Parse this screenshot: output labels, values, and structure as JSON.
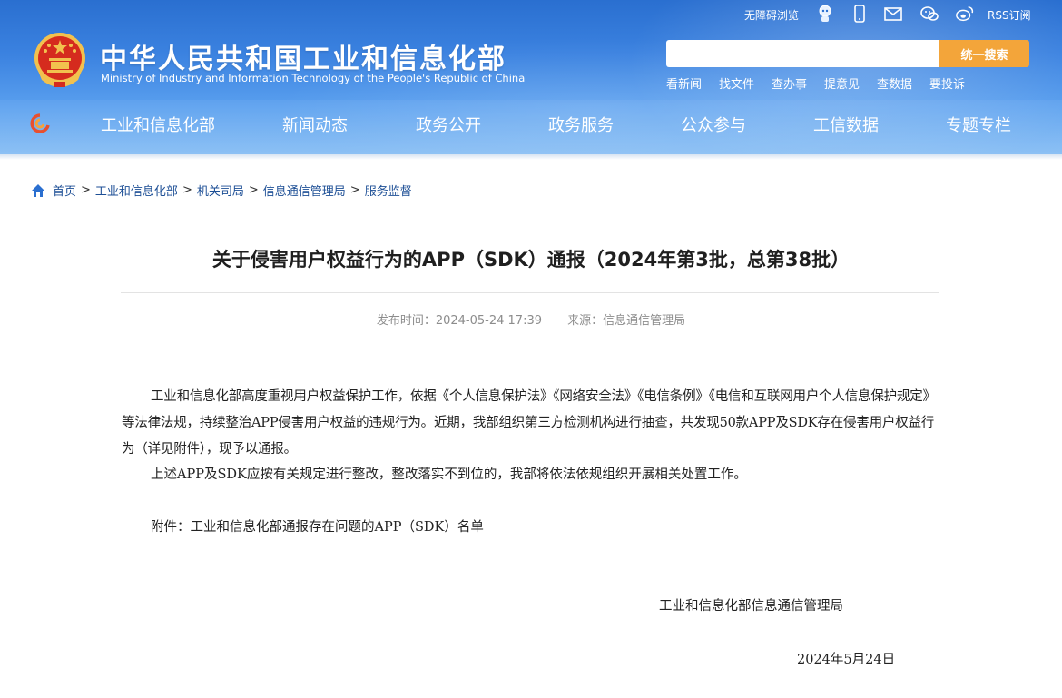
{
  "header": {
    "title": "中华人民共和国工业和信息化部",
    "subtitle": "Ministry of Industry and Information Technology of the People's Republic of China",
    "accessibility": "无障碍浏览",
    "rss": "RSS订阅",
    "search_placeholder": "",
    "search_button": "统一搜索",
    "quick_links": [
      "看新闻",
      "找文件",
      "查办事",
      "提意见",
      "查数据",
      "要投诉"
    ]
  },
  "nav": {
    "items": [
      "工业和信息化部",
      "新闻动态",
      "政务公开",
      "政务服务",
      "公众参与",
      "工信数据",
      "专题专栏"
    ]
  },
  "breadcrumb": {
    "items": [
      "首页",
      "工业和信息化部",
      "机关司局",
      "信息通信管理局",
      "服务监督"
    ],
    "separator": ">"
  },
  "article": {
    "title": "关于侵害用户权益行为的APP（SDK）通报（2024年第3批，总第38批）",
    "publish_time": "发布时间：2024-05-24 17:39",
    "source": "来源：信息通信管理局",
    "paragraph1": "工业和信息化部高度重视用户权益保护工作，依据《个人信息保护法》《网络安全法》《电信条例》《电信和互联网用户个人信息保护规定》等法律法规，持续整治APP侵害用户权益的违规行为。近期，我部组织第三方检测机构进行抽查，共发现50款APP及SDK存在侵害用户权益行为（详见附件），现予以通报。",
    "paragraph2": "上述APP及SDK应按有关规定进行整改，整改落实不到位的，我部将依法依规组织开展相关处置工作。",
    "attachment": "附件：工业和信息化部通报存在问题的APP（SDK）名单",
    "signer": "工业和信息化部信息通信管理局",
    "date": "2024年5月24日"
  },
  "colors": {
    "header_blue": "#3b82e0",
    "search_button": "#f3a53a",
    "link": "#1c4e95",
    "emblem_red": "#d52b1e",
    "emblem_gold": "#f2c14e"
  },
  "icons": [
    "emblem-icon",
    "robot-icon",
    "mobile-icon",
    "mail-icon",
    "wechat-icon",
    "weibo-icon",
    "nav-logo-icon",
    "home-icon"
  ]
}
